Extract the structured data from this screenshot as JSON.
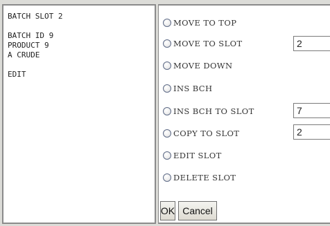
{
  "left_panel": {
    "lines": [
      "BATCH SLOT 2",
      "",
      "BATCH ID 9",
      "PRODUCT 9",
      "A CRUDE",
      "",
      "EDIT"
    ]
  },
  "options": [
    {
      "label": "MOVE TO TOP"
    },
    {
      "label": "MOVE TO SLOT",
      "value": "2"
    },
    {
      "label": "MOVE DOWN"
    },
    {
      "label": "INS BCH"
    },
    {
      "label": "INS BCH TO SLOT",
      "value": "7"
    },
    {
      "label": "COPY TO SLOT",
      "value": "2"
    },
    {
      "label": "EDIT SLOT"
    },
    {
      "label": "DELETE SLOT"
    }
  ],
  "buttons": {
    "ok_label": "OK",
    "cancel_label": "Cancel"
  }
}
